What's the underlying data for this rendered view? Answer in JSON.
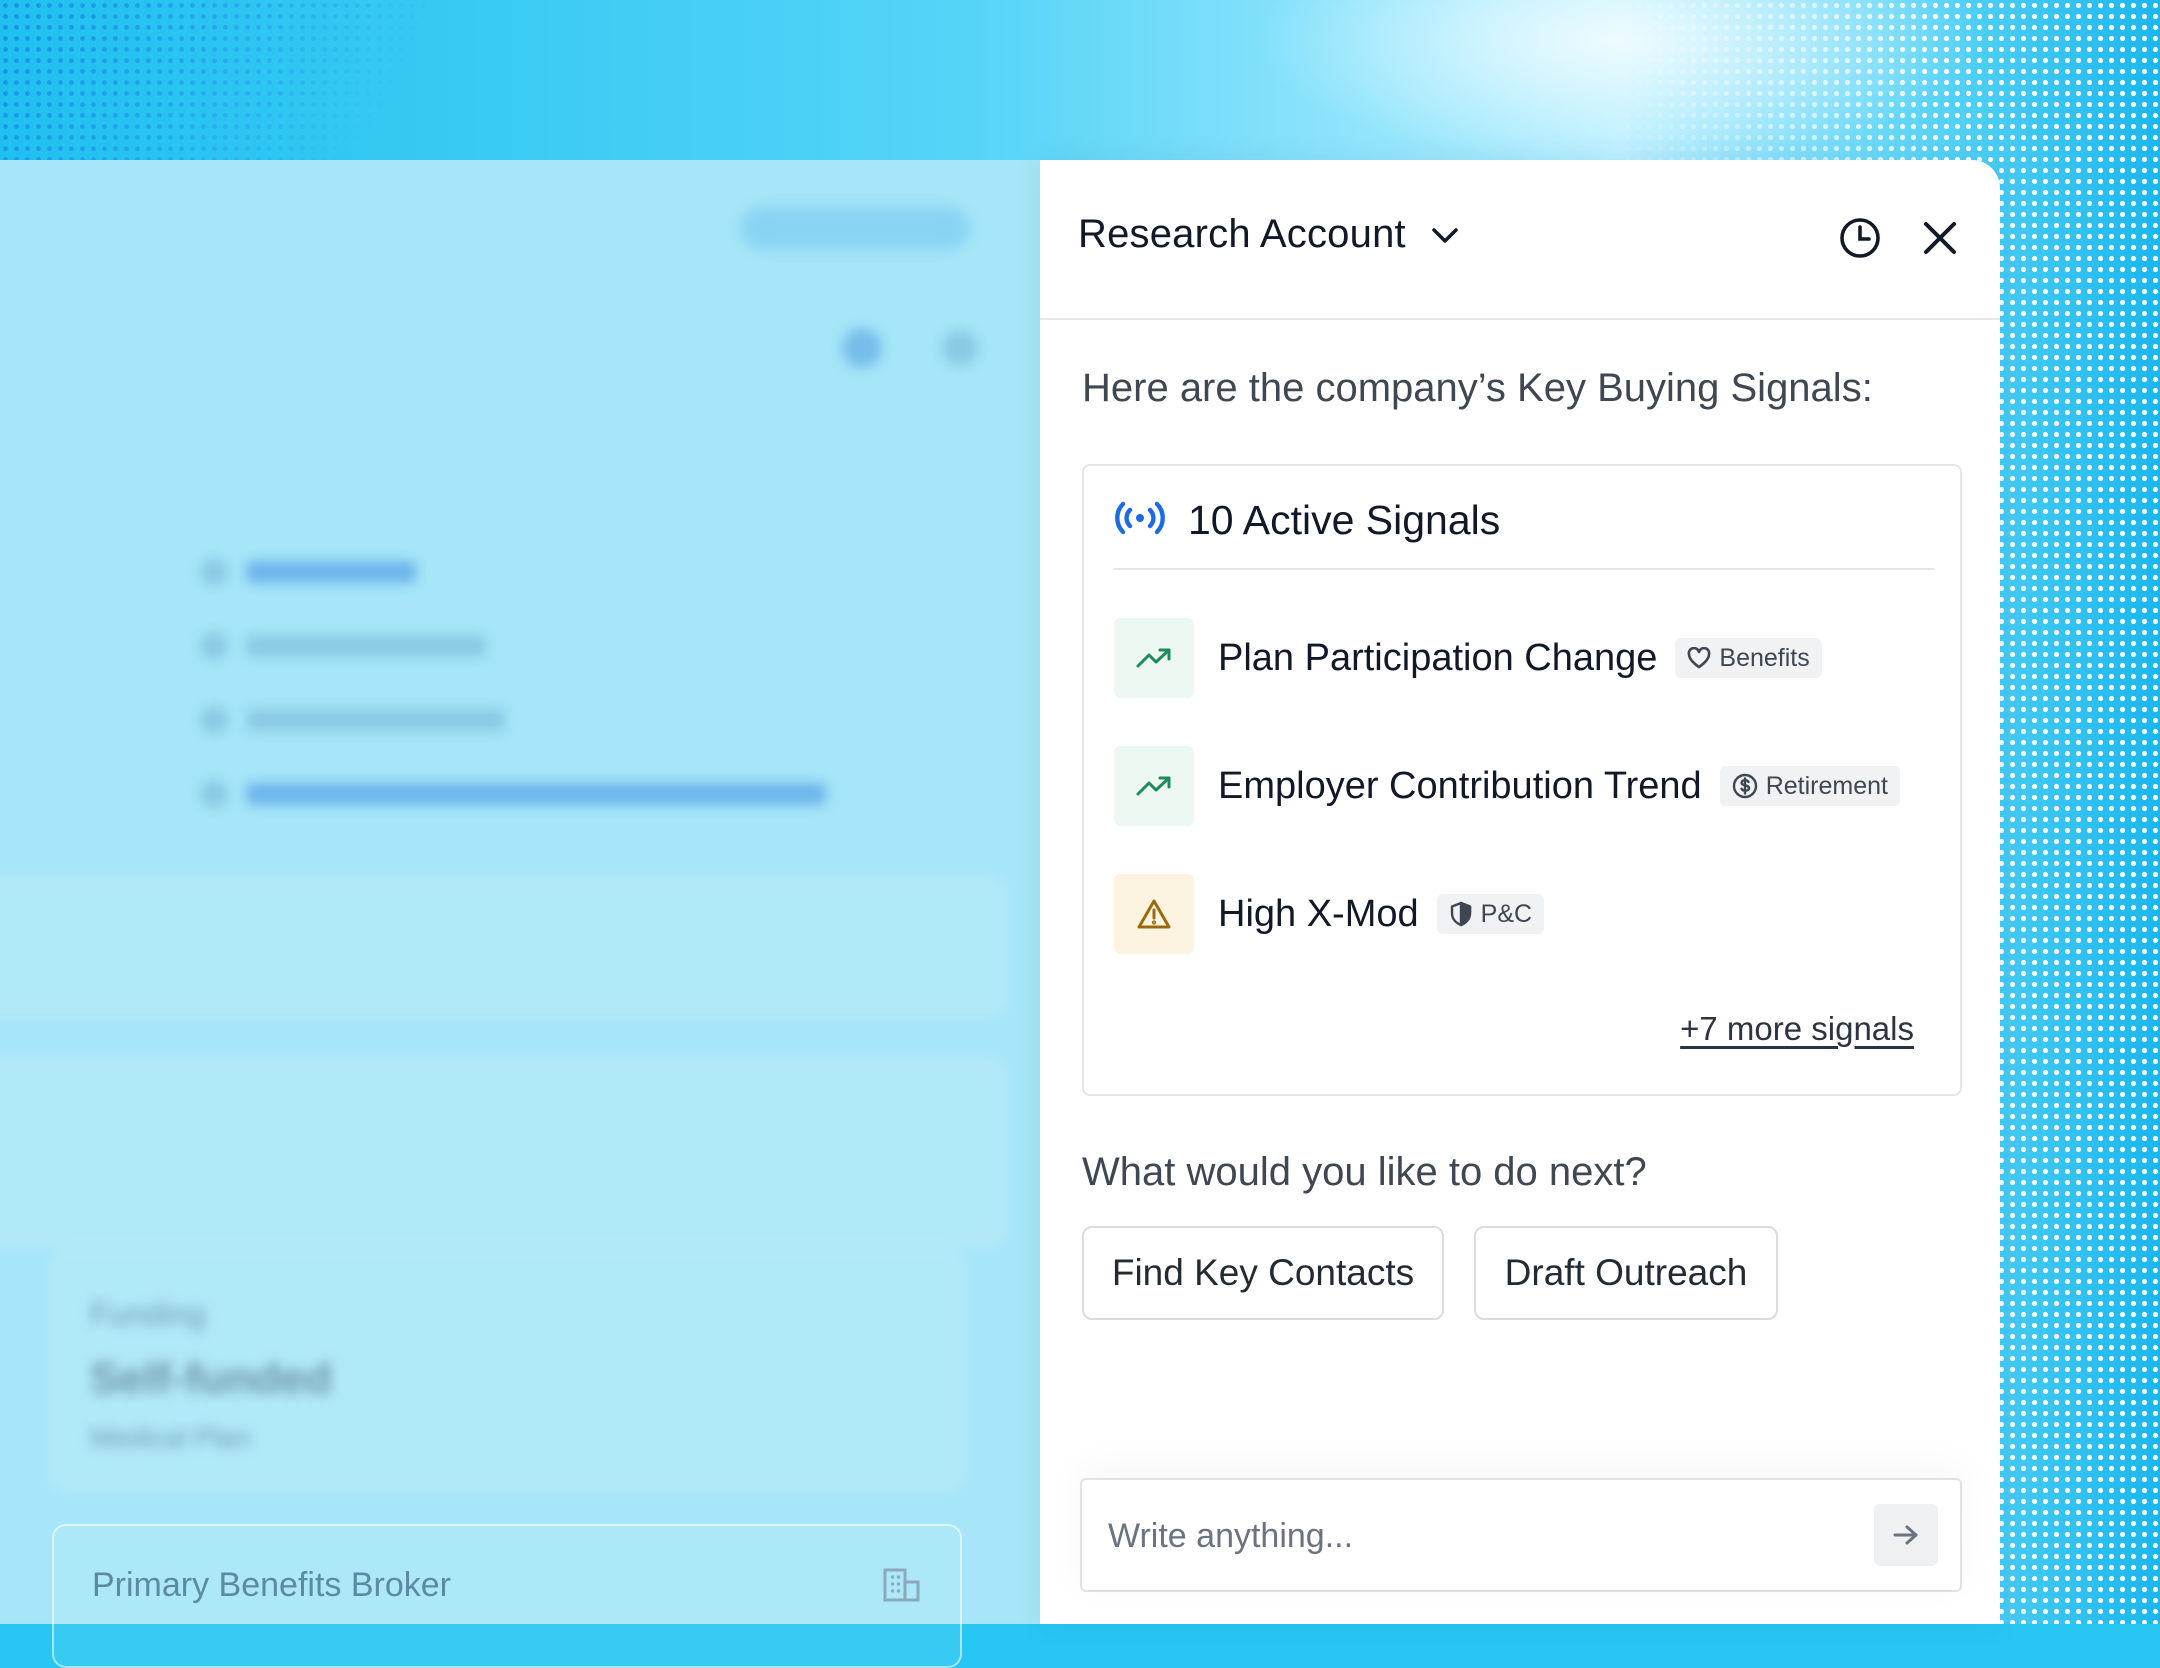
{
  "panel": {
    "title": "Research Account",
    "intro": "Here are the company’s Key Buying Signals:",
    "signals": {
      "header": "10 Active Signals",
      "items": [
        {
          "label": "Plan Participation Change",
          "tag": "Benefits",
          "icon": "trending-up-icon",
          "tag_icon": "heart-icon"
        },
        {
          "label": "Employer Contribution Trend",
          "tag": "Retirement",
          "icon": "trending-up-icon",
          "tag_icon": "dollar-circle-icon"
        },
        {
          "label": "High X-Mod",
          "tag": "P&C",
          "icon": "warning-icon",
          "tag_icon": "shield-icon"
        }
      ],
      "more": "+7 more signals"
    },
    "next_question": "What would you like to do next?",
    "actions": [
      "Find Key Contacts",
      "Draft Outreach"
    ],
    "input": {
      "placeholder": "Write anything..."
    }
  },
  "background_app": {
    "funding_label": "Funding",
    "funding_value": "Self-funded",
    "funding_sub": "Medical Plan",
    "broker_label": "Primary Benefits Broker"
  },
  "colors": {
    "accent_blue": "#1d6ae5",
    "trend_green": "#1f8a5a",
    "warning_amber": "#9a6a0a",
    "background_cyan": "#28c6f2"
  }
}
